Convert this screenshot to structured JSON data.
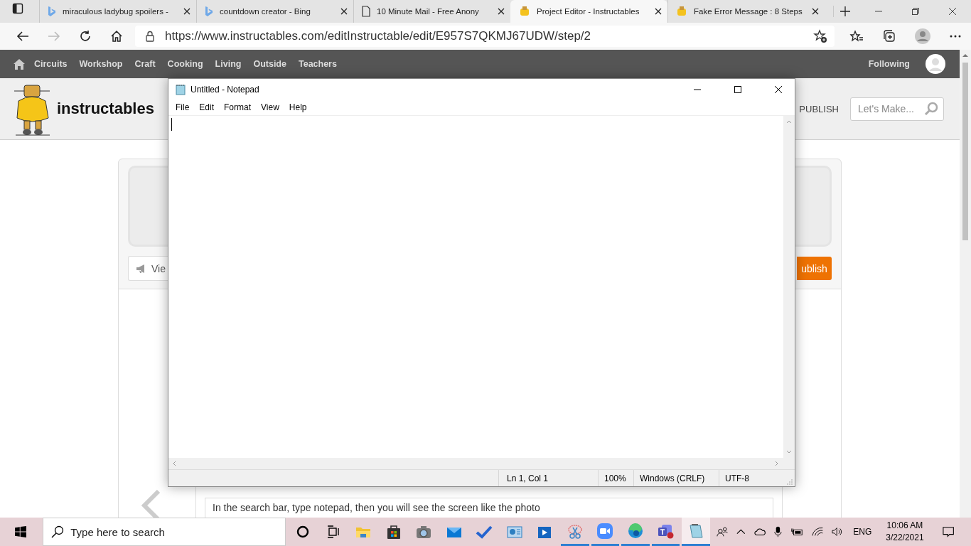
{
  "browser": {
    "tabs": [
      {
        "title": "miraculous ladybug spoilers -",
        "kind": "bing",
        "selected": false
      },
      {
        "title": "countdown creator - Bing",
        "kind": "bing",
        "selected": false
      },
      {
        "title": "10 Minute Mail - Free Anony",
        "kind": "page",
        "selected": false
      },
      {
        "title": "Project Editor - Instructables",
        "kind": "robot",
        "selected": true
      },
      {
        "title": "Fake Error Message : 8 Steps",
        "kind": "robot",
        "selected": false
      }
    ],
    "url": "https://www.instructables.com/editInstructable/edit/E957S7QKMJ67UDW/step/2"
  },
  "site": {
    "nav_items": [
      "Circuits",
      "Workshop",
      "Craft",
      "Cooking",
      "Living",
      "Outside",
      "Teachers"
    ],
    "following": "Following",
    "logo": "instructables",
    "publish_link": "PUBLISH",
    "search": {
      "placeholder": "Let's Make..."
    },
    "view_button": "Vie",
    "publish_button": "ublish",
    "step_text": "In the search bar, type notepad, then you will see the screen like the photo"
  },
  "notepad": {
    "title": "Untitled - Notepad",
    "menu": [
      "File",
      "Edit",
      "Format",
      "View",
      "Help"
    ],
    "status": [
      "Ln 1, Col 1",
      "100%",
      "Windows (CRLF)",
      "UTF-8"
    ]
  },
  "taskbar": {
    "search": {
      "placeholder": "Type here to search"
    },
    "apps": [
      {
        "kind": "cortana",
        "running": false,
        "selected": false
      },
      {
        "kind": "taskview",
        "running": false,
        "selected": false
      },
      {
        "kind": "explorer",
        "running": false,
        "selected": false
      },
      {
        "kind": "store",
        "running": false,
        "selected": false
      },
      {
        "kind": "camera",
        "running": false,
        "selected": false
      },
      {
        "kind": "mail",
        "running": false,
        "selected": false
      },
      {
        "kind": "todo",
        "running": false,
        "selected": false
      },
      {
        "kind": "presentation",
        "running": false,
        "selected": false
      },
      {
        "kind": "video",
        "running": false,
        "selected": false
      },
      {
        "kind": "snip",
        "running": true,
        "selected": false
      },
      {
        "kind": "zoom",
        "running": true,
        "selected": false
      },
      {
        "kind": "edge",
        "running": true,
        "selected": false
      },
      {
        "kind": "teams",
        "running": true,
        "selected": false
      },
      {
        "kind": "notepad",
        "running": true,
        "selected": true
      }
    ],
    "language": "ENG",
    "time": "10:06 AM",
    "date": "3/22/2021"
  }
}
